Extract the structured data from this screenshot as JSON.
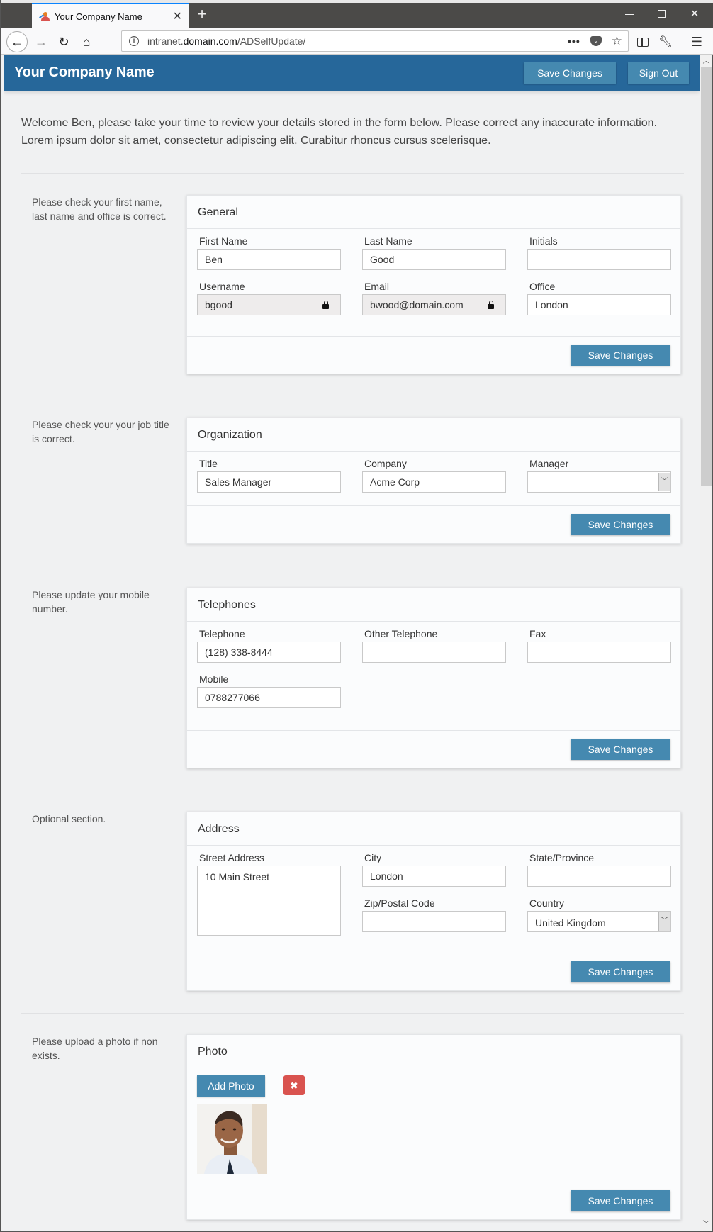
{
  "browser": {
    "tab_title": "Your Company Name",
    "url_host": "intranet.domain.com",
    "url_prefix": "intranet.",
    "url_domain": "domain.com",
    "url_path": "/ADSelfUpdate/",
    "icons": {
      "back": "arrow-left-icon",
      "forward": "arrow-right-icon",
      "reload": "reload-icon",
      "home": "home-icon",
      "info": "info-icon",
      "page_actions": "more-horizontal-icon",
      "pocket": "pocket-icon",
      "bookmark": "star-icon",
      "sidebar": "sidebar-icon",
      "tools": "wrench-icon",
      "menu": "hamburger-icon"
    }
  },
  "header": {
    "brand": "Your Company Name",
    "save_label": "Save Changes",
    "signout_label": "Sign Out",
    "color": "#26679a",
    "button_color": "#4589b0"
  },
  "welcome": "Welcome Ben, please take your time to review your details stored in the form below. Please correct any inaccurate information. Lorem ipsum dolor sit amet, consectetur adipiscing elit. Curabitur rhoncus cursus scelerisque.",
  "save_label": "Save Changes",
  "sections": {
    "general": {
      "help": "Please check your first name, last name and office is correct.",
      "title": "General",
      "fields": {
        "first_name": {
          "label": "First Name",
          "value": "Ben"
        },
        "last_name": {
          "label": "Last Name",
          "value": "Good"
        },
        "initials": {
          "label": "Initials",
          "value": ""
        },
        "username": {
          "label": "Username",
          "value": "bgood",
          "locked": true
        },
        "email": {
          "label": "Email",
          "value": "bwood@domain.com",
          "locked": true
        },
        "office": {
          "label": "Office",
          "value": "London"
        }
      }
    },
    "organization": {
      "help": "Please check your your job title is correct.",
      "title": "Organization",
      "fields": {
        "title": {
          "label": "Title",
          "value": "Sales Manager"
        },
        "company": {
          "label": "Company",
          "value": "Acme Corp"
        },
        "manager": {
          "label": "Manager",
          "value": ""
        }
      }
    },
    "telephones": {
      "help": "Please update your mobile number.",
      "title": "Telephones",
      "fields": {
        "telephone": {
          "label": "Telephone",
          "value": "(128) 338-8444"
        },
        "other_telephone": {
          "label": "Other Telephone",
          "value": ""
        },
        "fax": {
          "label": "Fax",
          "value": ""
        },
        "mobile": {
          "label": "Mobile",
          "value": "0788277066"
        }
      }
    },
    "address": {
      "help": "Optional section.",
      "title": "Address",
      "fields": {
        "street": {
          "label": "Street Address",
          "value": "10 Main Street"
        },
        "city": {
          "label": "City",
          "value": "London"
        },
        "state": {
          "label": "State/Province",
          "value": ""
        },
        "zip": {
          "label": "Zip/Postal Code",
          "value": ""
        },
        "country": {
          "label": "Country",
          "value": "United Kingdom"
        }
      }
    },
    "photo": {
      "help": "Please upload a photo if non exists.",
      "title": "Photo",
      "add_label": "Add Photo",
      "remove_glyph": "✖",
      "remove_color": "#d9534f"
    }
  }
}
